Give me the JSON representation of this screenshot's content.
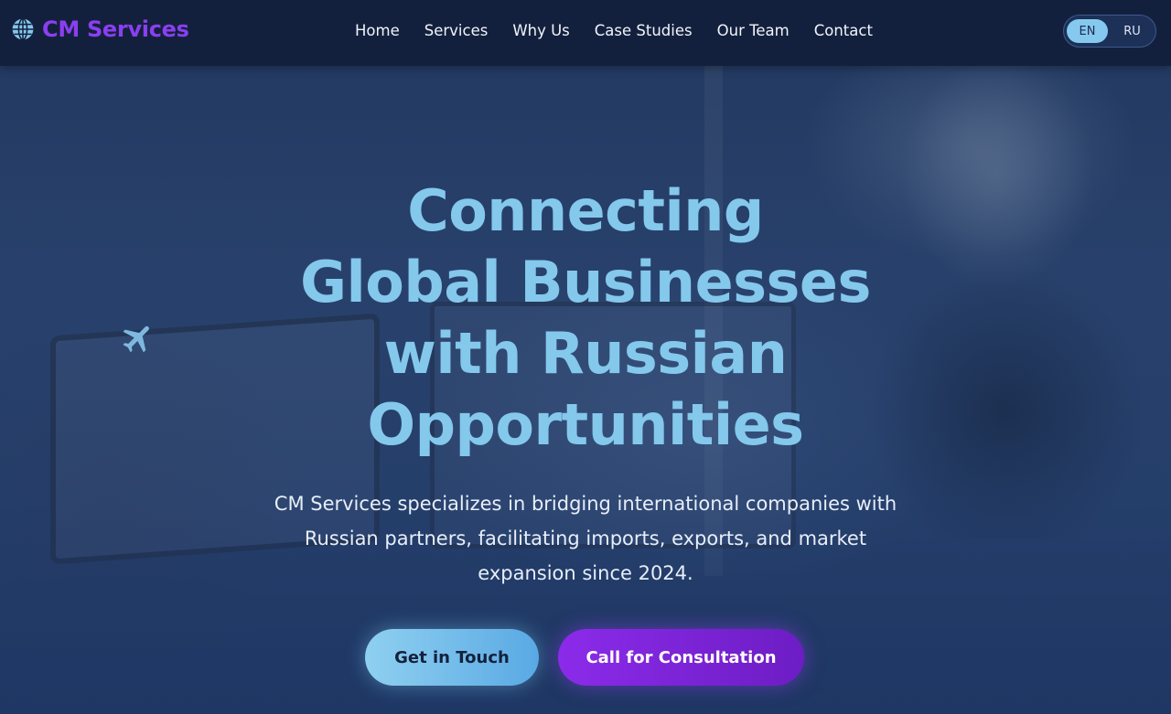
{
  "brand": {
    "name": "CM Services",
    "icon": "globe-icon",
    "color": "#8a3ff0"
  },
  "nav": {
    "items": [
      {
        "label": "Home"
      },
      {
        "label": "Services"
      },
      {
        "label": "Why Us"
      },
      {
        "label": "Case Studies"
      },
      {
        "label": "Our Team"
      },
      {
        "label": "Contact"
      }
    ]
  },
  "language": {
    "options": [
      "EN",
      "RU"
    ],
    "selected": "EN"
  },
  "hero": {
    "title_lines": [
      "Connecting",
      "Global Businesses",
      "with Russian",
      "Opportunities"
    ],
    "subtitle_lines": [
      "CM Services specializes in bridging international companies with",
      "Russian partners, facilitating imports, exports, and market",
      "expansion since 2024."
    ],
    "decor_icon": "airplane-icon",
    "primary_button": "Get in Touch",
    "secondary_button": "Call for Consultation"
  },
  "colors": {
    "nav_bg": "#13203d",
    "title": "#84c8ec",
    "primary_button": "#8fd0f0",
    "secondary_button": "#8b2bea"
  }
}
